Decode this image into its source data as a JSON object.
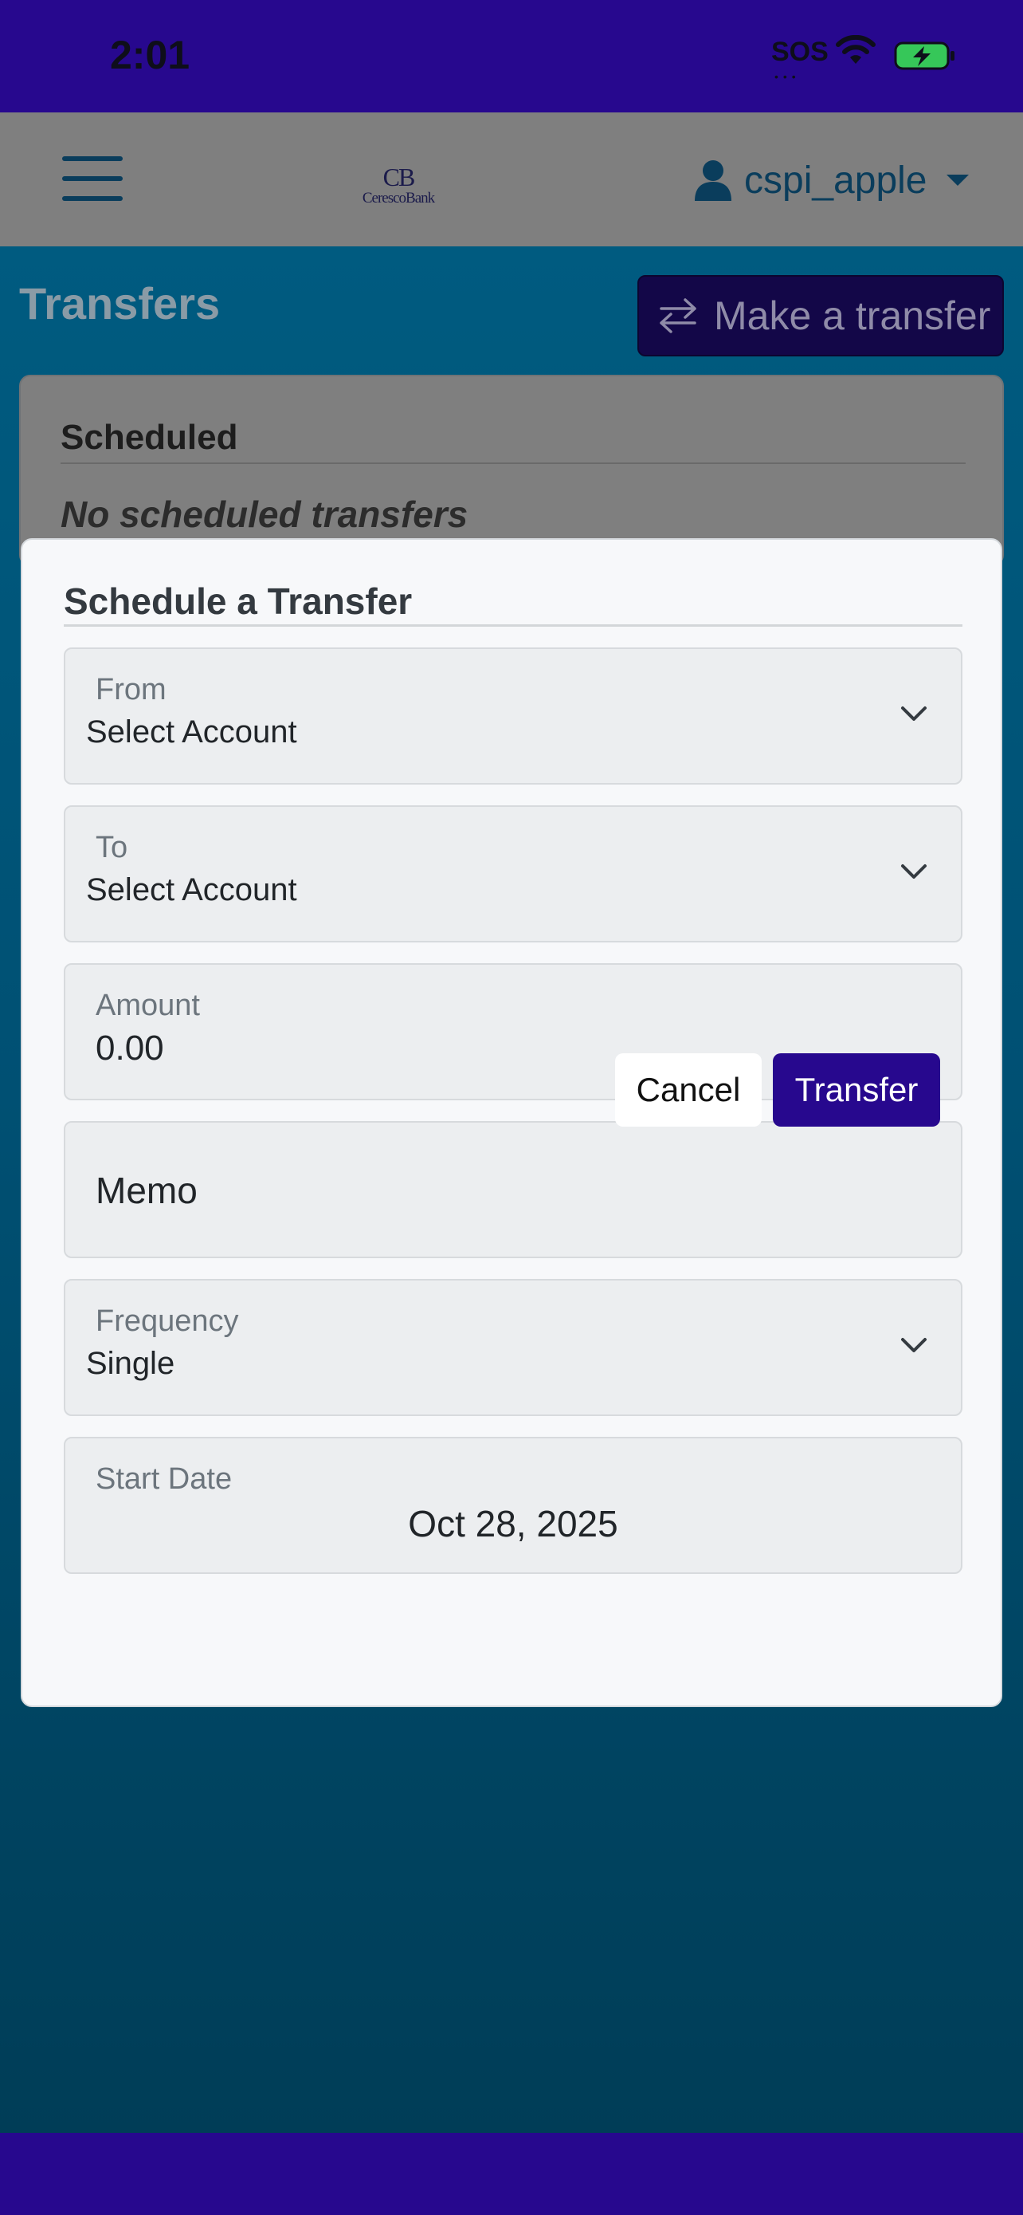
{
  "status_bar": {
    "time": "2:01",
    "sos": "SOS"
  },
  "navbar": {
    "brand_mark": "CB",
    "brand_name": "CerescoBank",
    "username": "cspi_apple"
  },
  "page": {
    "title": "Transfers",
    "make_transfer_label": "Make a transfer"
  },
  "scheduled_card": {
    "title": "Scheduled",
    "empty_text": "No scheduled transfers"
  },
  "modal": {
    "title": "Schedule a Transfer",
    "from": {
      "label": "From",
      "value": "Select Account"
    },
    "to": {
      "label": "To",
      "value": "Select Account"
    },
    "amount": {
      "label": "Amount",
      "value": "0.00"
    },
    "memo": {
      "placeholder": "Memo"
    },
    "frequency": {
      "label": "Frequency",
      "value": "Single"
    },
    "start_date": {
      "label": "Start Date",
      "value": "Oct 28, 2025"
    },
    "cancel_label": "Cancel",
    "transfer_label": "Transfer"
  },
  "colors": {
    "brand": "#27088e",
    "navbar_overlay": "#7f7f7f",
    "page_bg": "#005073"
  }
}
